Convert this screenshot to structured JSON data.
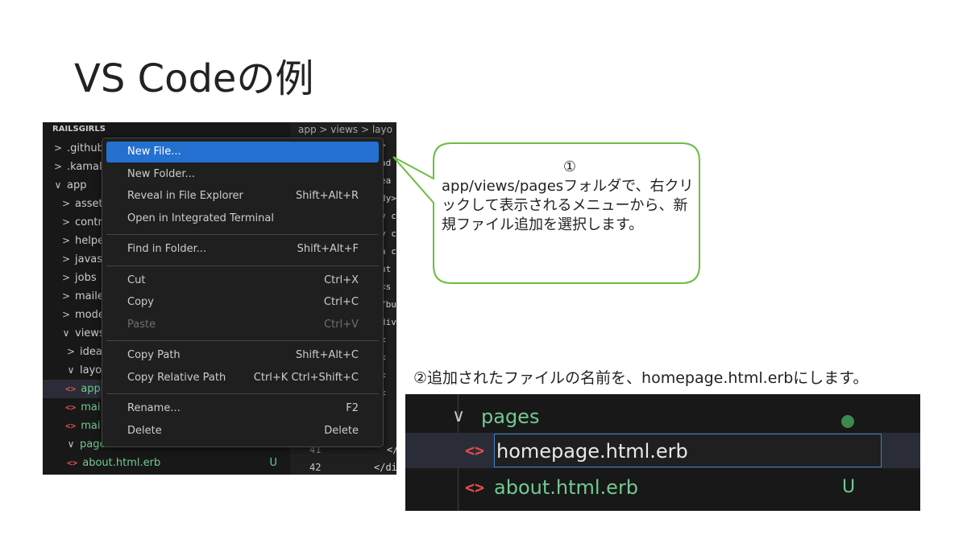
{
  "slide": {
    "title": "VS Codeの例",
    "callout": {
      "number": "①",
      "text": "app/views/pagesフォルダで、右クリックして表示されるメニューから、新規ファイル追加を選択します。"
    },
    "step2": "②追加されたファイルの名前を、homepage.html.erbにします。"
  },
  "explorer": {
    "header": "RAILSGIRLS",
    "items": [
      {
        "label": ".github",
        "chevron": ">"
      },
      {
        "label": ".kamal",
        "chevron": ">"
      },
      {
        "label": "app",
        "chevron": "∨"
      },
      {
        "label": "assets",
        "chevron": ">"
      },
      {
        "label": "contro",
        "chevron": ">"
      },
      {
        "label": "helper",
        "chevron": ">"
      },
      {
        "label": "javasc",
        "chevron": ">"
      },
      {
        "label": "jobs",
        "chevron": ">"
      },
      {
        "label": "mailer",
        "chevron": ">"
      },
      {
        "label": "model",
        "chevron": ">"
      },
      {
        "label": "views",
        "chevron": "∨"
      },
      {
        "label": "ideas",
        "chevron": ">"
      },
      {
        "label": "layou",
        "chevron": "∨"
      },
      {
        "label": "app",
        "icon": "<>"
      },
      {
        "label": "mai",
        "icon": "<>"
      },
      {
        "label": "mai",
        "icon": "<>"
      },
      {
        "label": "pages",
        "chevron": "∨"
      },
      {
        "label": "about.html.erb",
        "icon": "<>",
        "badge": "U"
      }
    ]
  },
  "editor": {
    "breadcrumb": "app > views > layo",
    "code_fragments": [
      ">",
      "ad",
      "ea",
      "dy>",
      "v c",
      "v c",
      "a c",
      "ut",
      "<s",
      "/bu",
      "div",
      "<",
      "<",
      "<",
      "<"
    ],
    "line_numbers": [
      "41",
      "42"
    ],
    "code_end": [
      "</",
      "</di"
    ]
  },
  "context_menu": {
    "groups": [
      [
        {
          "label": "New File...",
          "shortcut": "",
          "active": true
        },
        {
          "label": "New Folder...",
          "shortcut": ""
        },
        {
          "label": "Reveal in File Explorer",
          "shortcut": "Shift+Alt+R"
        },
        {
          "label": "Open in Integrated Terminal",
          "shortcut": ""
        }
      ],
      [
        {
          "label": "Find in Folder...",
          "shortcut": "Shift+Alt+F"
        }
      ],
      [
        {
          "label": "Cut",
          "shortcut": "Ctrl+X"
        },
        {
          "label": "Copy",
          "shortcut": "Ctrl+C"
        },
        {
          "label": "Paste",
          "shortcut": "Ctrl+V",
          "disabled": true
        }
      ],
      [
        {
          "label": "Copy Path",
          "shortcut": "Shift+Alt+C"
        },
        {
          "label": "Copy Relative Path",
          "shortcut": "Ctrl+K Ctrl+Shift+C"
        }
      ],
      [
        {
          "label": "Rename...",
          "shortcut": "F2"
        },
        {
          "label": "Delete",
          "shortcut": "Delete"
        }
      ]
    ]
  },
  "rename_view": {
    "folder": "pages",
    "input_value": "homepage.html.erb",
    "file": "about.html.erb",
    "file_icon": "<>",
    "badge": "U"
  },
  "colors": {
    "accent": "#2470d0",
    "callout_border": "#6abf40",
    "git_untracked": "#73c991",
    "html_icon": "#e44d4d"
  }
}
